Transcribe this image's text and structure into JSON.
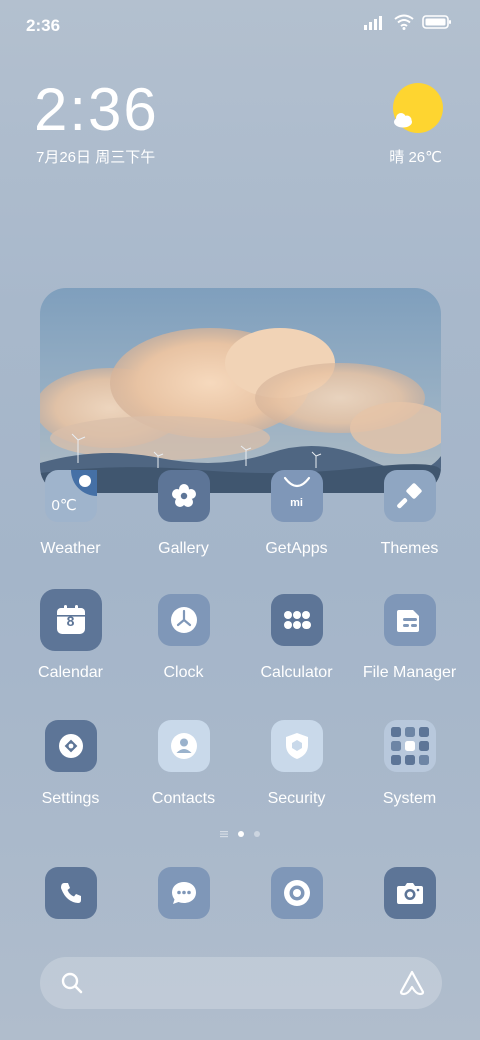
{
  "status_bar": {
    "time": "2:36"
  },
  "clock": {
    "time": "2:36",
    "date": "7月26日 周三下午"
  },
  "weather": {
    "text": "晴 26℃"
  },
  "weather_widget": {
    "temp": "0℃"
  },
  "apps_row1": [
    {
      "label": "Weather",
      "icon": "weather-icon"
    },
    {
      "label": "Gallery",
      "icon": "flower-icon"
    },
    {
      "label": "GetApps",
      "icon": "shopping-bag-icon",
      "badge": "mi"
    },
    {
      "label": "Themes",
      "icon": "paintbrush-icon"
    }
  ],
  "apps_row2": [
    {
      "label": "Calendar",
      "icon": "calendar-icon",
      "day": "8"
    },
    {
      "label": "Clock",
      "icon": "clock-icon"
    },
    {
      "label": "Calculator",
      "icon": "calculator-icon"
    },
    {
      "label": "File Manager",
      "icon": "folder-icon"
    }
  ],
  "apps_row3": [
    {
      "label": "Settings",
      "icon": "settings-icon"
    },
    {
      "label": "Contacts",
      "icon": "contact-icon"
    },
    {
      "label": "Security",
      "icon": "shield-icon"
    },
    {
      "label": "System",
      "icon": "folder-grid-icon"
    }
  ],
  "dock": [
    {
      "icon": "phone-icon"
    },
    {
      "icon": "message-icon"
    },
    {
      "icon": "browser-icon"
    },
    {
      "icon": "camera-icon"
    }
  ],
  "page_indicator": {
    "pages": 3,
    "active": 2
  },
  "colors": {
    "dark_tile": "#5d7597",
    "mid_tile": "#7f97b8",
    "light_tile": "#c9d9ea",
    "sun": "#fed530"
  }
}
